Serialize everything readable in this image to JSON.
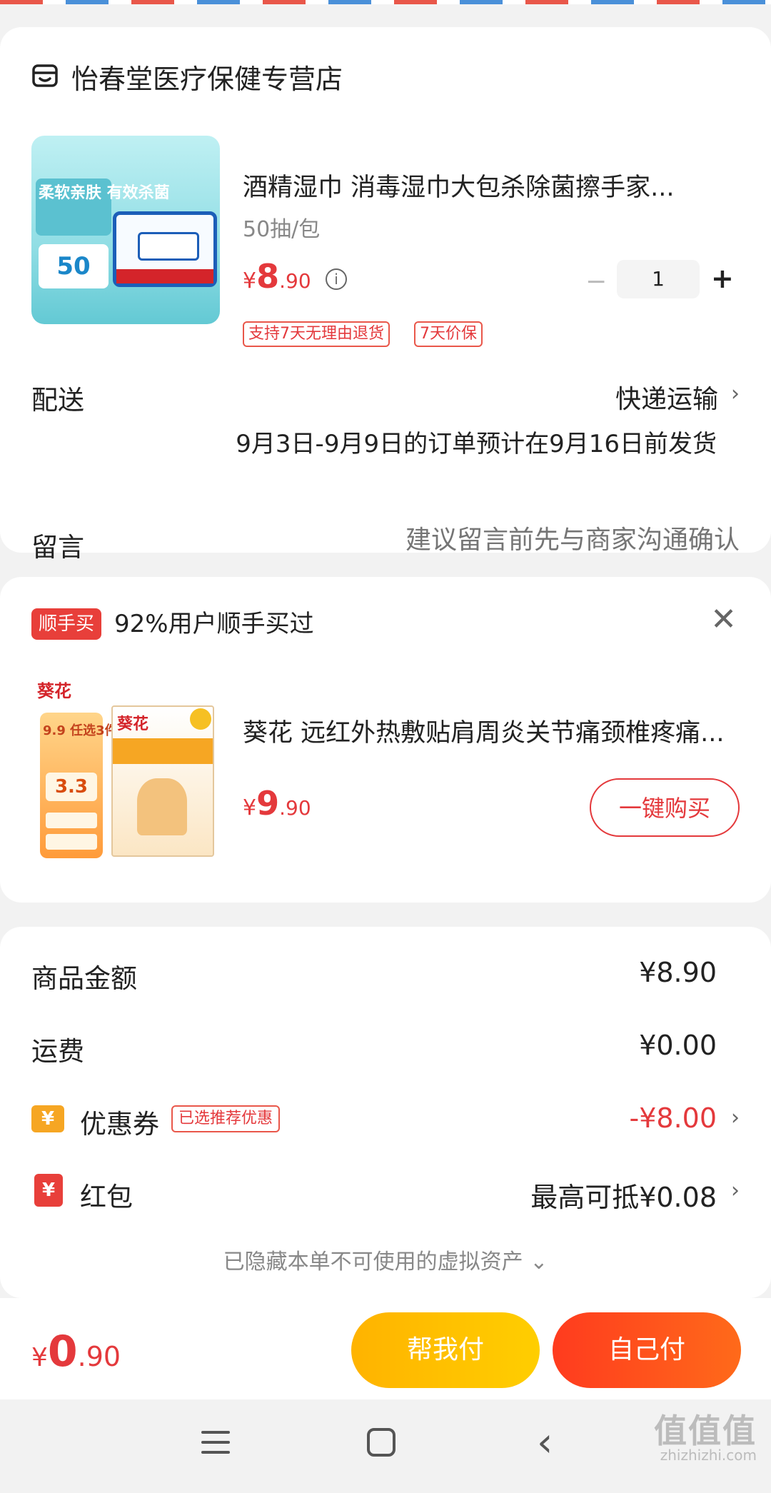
{
  "shop": {
    "name": "怡春堂医疗保健专营店",
    "product": {
      "title": "酒精湿巾 消毒湿巾大包杀除菌擦手家...",
      "spec": "50抽/包",
      "price_symbol": "¥",
      "price_int": "8",
      "price_dec": ".90",
      "quantity": "1",
      "minus": "−",
      "plus": "+",
      "badges": [
        "支持7天无理由退货",
        "7天价保"
      ],
      "image_text": {
        "tag": "柔软亲肤 有效杀菌",
        "count": "50"
      }
    },
    "shipping": {
      "label": "配送",
      "method": "快递运输",
      "note": "9月3日-9月9日的订单预计在9月16日前发货"
    },
    "message": {
      "label": "留言",
      "placeholder": "建议留言前先与商家沟通确认"
    }
  },
  "addon": {
    "tag": "顺手买",
    "text": "92%用户顺手买过",
    "product": {
      "title": "葵花 远红外热敷贴肩周炎关节痛颈椎疼痛...",
      "price_symbol": "¥",
      "price_int": "9",
      "price_dec": ".90",
      "image_text": {
        "logo": "葵花",
        "promo": "9.9 任选3件",
        "unit": "3.3",
        "box_logo": "葵花"
      }
    },
    "buy_button": "一键购买"
  },
  "summary": {
    "goods_label": "商品金额",
    "goods_value": "¥8.90",
    "freight_label": "运费",
    "freight_value": "¥0.00",
    "coupon_label": "优惠券",
    "coupon_tag": "已选推荐优惠",
    "coupon_value": "-¥8.00",
    "redpacket_label": "红包",
    "redpacket_value": "最高可抵¥0.08",
    "hidden_note": "已隐藏本单不可使用的虚拟资产 ⌄"
  },
  "bottom": {
    "total_symbol": "¥",
    "total_int": "0",
    "total_dec": ".90",
    "help_pay": "帮我付",
    "self_pay": "自己付"
  },
  "watermark": {
    "main": "值值值",
    "sub": "zhizhizhi.com"
  },
  "colors": {
    "accent_red": "#e4393c",
    "help_yellow": "#ffb300",
    "self_orange": "#ff4b1e"
  }
}
